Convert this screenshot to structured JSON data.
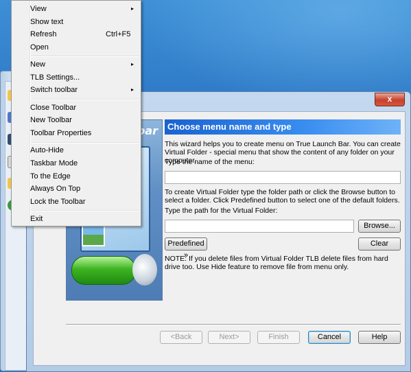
{
  "menu": {
    "items": [
      {
        "label": "View",
        "shortcut": "",
        "arrow": "▸"
      },
      {
        "label": "Show text",
        "shortcut": "",
        "arrow": ""
      },
      {
        "label": "Refresh",
        "shortcut": "Ctrl+F5",
        "arrow": ""
      },
      {
        "label": "Open",
        "shortcut": "",
        "arrow": ""
      },
      {
        "label": "New",
        "shortcut": "",
        "arrow": "▸"
      },
      {
        "label": "TLB Settings...",
        "shortcut": "",
        "arrow": ""
      },
      {
        "label": "Switch toolbar",
        "shortcut": "",
        "arrow": "▸"
      },
      {
        "label": "Close Toolbar",
        "shortcut": "",
        "arrow": ""
      },
      {
        "label": "New Toolbar",
        "shortcut": "",
        "arrow": ""
      },
      {
        "label": "Toolbar Properties",
        "shortcut": "",
        "arrow": ""
      },
      {
        "label": "Auto-Hide",
        "shortcut": "",
        "arrow": ""
      },
      {
        "label": "Taskbar Mode",
        "shortcut": "",
        "arrow": ""
      },
      {
        "label": "To the Edge",
        "shortcut": "",
        "arrow": ""
      },
      {
        "label": "Always On Top",
        "shortcut": "",
        "arrow": ""
      },
      {
        "label": "Lock the Toolbar",
        "shortcut": "",
        "arrow": ""
      },
      {
        "label": "Exit",
        "shortcut": "",
        "arrow": ""
      }
    ]
  },
  "window": {
    "close_glyph": "x"
  },
  "wizard": {
    "banner_text": "bar",
    "header": "Choose menu name and type",
    "intro": "This wizard helps you to create menu on True Launch Bar. You can create Virtual Folder - special menu that show the content of any folder on your computer.",
    "name_label": "Type the name of the menu:",
    "name_value": "",
    "folder_help": "To create Virtual Folder type the folder path or click the Browse button to select a folder. Click Predefined button to select one of the default folders.",
    "path_label": "Type the path for the Virtual Folder:",
    "path_value": "",
    "browse_label": "Browse...",
    "predefined_label": "Predefined »",
    "clear_label": "Clear",
    "note": "NOTE: If you delete files from Virtual Folder TLB delete files from hard drive too. Use Hide feature to remove file from menu only."
  },
  "footer": {
    "back_label": "<Back",
    "next_label": "Next>",
    "finish_label": "Finish",
    "cancel_label": "Cancel",
    "help_label": "Help"
  },
  "colors": {
    "desktop": "#2a73c2",
    "header_bar": "#1a62d0",
    "close_button": "#c7412b"
  }
}
